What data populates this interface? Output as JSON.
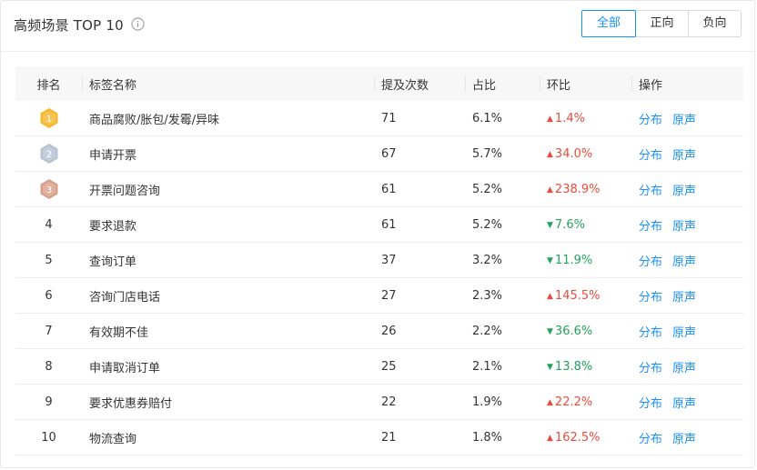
{
  "header": {
    "title": "高频场景 TOP 10",
    "filters": [
      {
        "label": "全部",
        "active": true
      },
      {
        "label": "正向",
        "active": false
      },
      {
        "label": "负向",
        "active": false
      }
    ]
  },
  "table": {
    "columns": [
      "排名",
      "标签名称",
      "提及次数",
      "占比",
      "环比",
      "操作"
    ],
    "actions": {
      "distribution": "分布",
      "original": "原声"
    },
    "rows": [
      {
        "rank": "1",
        "name": "商品腐败/胀包/发霉/异味",
        "count": "71",
        "ratio": "6.1%",
        "change": "1.4%",
        "dir": "up"
      },
      {
        "rank": "2",
        "name": "申请开票",
        "count": "67",
        "ratio": "5.7%",
        "change": "34.0%",
        "dir": "up"
      },
      {
        "rank": "3",
        "name": "开票问题咨询",
        "count": "61",
        "ratio": "5.2%",
        "change": "238.9%",
        "dir": "up"
      },
      {
        "rank": "4",
        "name": "要求退款",
        "count": "61",
        "ratio": "5.2%",
        "change": "7.6%",
        "dir": "down"
      },
      {
        "rank": "5",
        "name": "查询订单",
        "count": "37",
        "ratio": "3.2%",
        "change": "11.9%",
        "dir": "down"
      },
      {
        "rank": "6",
        "name": "咨询门店电话",
        "count": "27",
        "ratio": "2.3%",
        "change": "145.5%",
        "dir": "up"
      },
      {
        "rank": "7",
        "name": "有效期不佳",
        "count": "26",
        "ratio": "2.2%",
        "change": "36.6%",
        "dir": "down"
      },
      {
        "rank": "8",
        "name": "申请取消订单",
        "count": "25",
        "ratio": "2.1%",
        "change": "13.8%",
        "dir": "down"
      },
      {
        "rank": "9",
        "name": "要求优惠券赔付",
        "count": "22",
        "ratio": "1.9%",
        "change": "22.2%",
        "dir": "up"
      },
      {
        "rank": "10",
        "name": "物流查询",
        "count": "21",
        "ratio": "1.8%",
        "change": "162.5%",
        "dir": "up"
      }
    ]
  },
  "colors": {
    "accent": "#1890ff",
    "up": "#e74c3c",
    "down": "#22a35a",
    "gold": "#f5b82e",
    "silver": "#b8c4d4",
    "bronze": "#d9a08c"
  }
}
